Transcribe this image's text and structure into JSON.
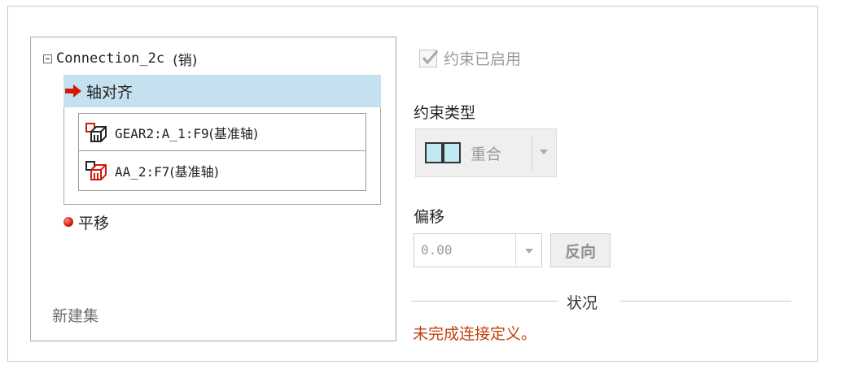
{
  "tree": {
    "root_label": "Connection_2c",
    "root_type": "(销)",
    "selected_constraint": "轴对齐",
    "references": [
      {
        "label_code": "GEAR2:A_1:F9",
        "label_cn": "(基准轴)"
      },
      {
        "label_code": "AA_2:F7",
        "label_cn": "(基准轴)"
      }
    ],
    "second_constraint": "平移",
    "new_set": "新建集"
  },
  "settings": {
    "enabled_label": "约束已启用",
    "enabled_checked": true,
    "type_label": "约束类型",
    "type_value": "重合",
    "offset_label": "偏移",
    "offset_value": "0.00",
    "flip_label": "反向"
  },
  "status": {
    "title": "状况",
    "message": "未完成连接定义。"
  },
  "colors": {
    "selection": "#c5e0ee",
    "status_message": "#c2410c",
    "arrow": "#d11a0a"
  }
}
